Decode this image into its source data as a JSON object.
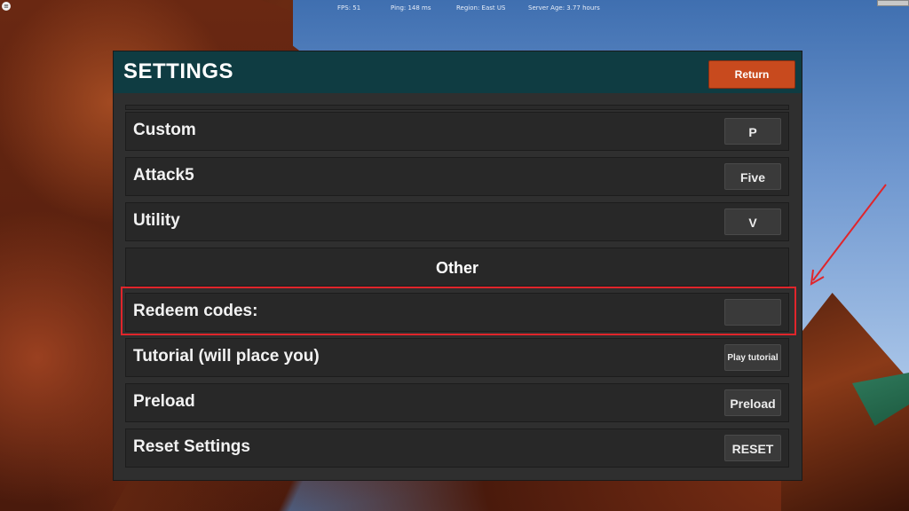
{
  "overlay_stats": {
    "fps": "FPS: 51",
    "ping": "Ping: 148 ms",
    "region": "Region: East US",
    "server_age": "Server Age: 3.77 hours"
  },
  "settings": {
    "title": "SETTINGS",
    "return_label": "Return",
    "rows": [
      {
        "label": "Custom",
        "button": "P"
      },
      {
        "label": "Attack5",
        "button": "Five"
      },
      {
        "label": "Utility",
        "button": "V"
      }
    ],
    "section_other": "Other",
    "redeem": {
      "label": "Redeem codes:",
      "value": ""
    },
    "tutorial": {
      "label": "Tutorial (will place you)",
      "button": "Play tutorial"
    },
    "preload": {
      "label": "Preload",
      "button": "Preload"
    },
    "reset": {
      "label": "Reset Settings",
      "button": "RESET"
    }
  },
  "colors": {
    "header": "#0f3c42",
    "return_button": "#c84a1e",
    "highlight": "#e0252b",
    "panel": "#2f2f2f"
  },
  "icons": [
    "roblox-menu-icon",
    "annotation-arrow-icon"
  ]
}
